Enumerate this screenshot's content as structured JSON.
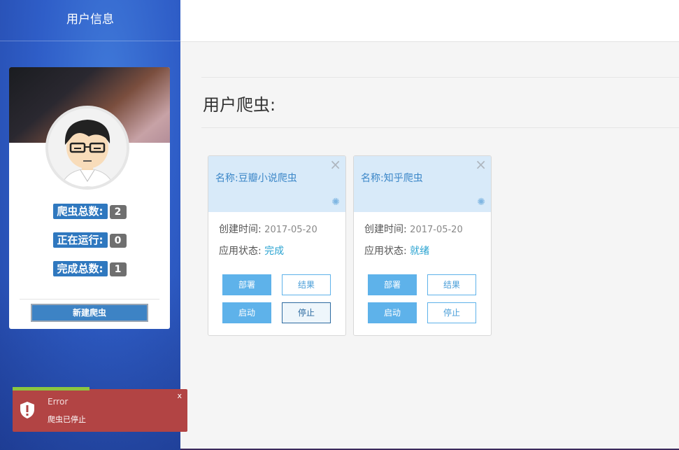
{
  "sidebar": {
    "title": "用户信息",
    "stats": [
      {
        "label": "爬虫总数:",
        "count": "2"
      },
      {
        "label": "正在运行:",
        "count": "0"
      },
      {
        "label": "完成总数:",
        "count": "1"
      }
    ],
    "new_button": "新建爬虫"
  },
  "main": {
    "title": "用户爬虫:"
  },
  "cards": [
    {
      "name": "名称:豆瓣小说爬虫",
      "created_label": "创建时间:",
      "created_value": "2017-05-20",
      "status_label": "应用状态:",
      "status_value": "完成",
      "buttons": {
        "deploy": "部署",
        "result": "结果",
        "start": "启动",
        "stop": "停止"
      },
      "close": "×"
    },
    {
      "name": "名称:知乎爬虫",
      "created_label": "创建时间:",
      "created_value": "2017-05-20",
      "status_label": "应用状态:",
      "status_value": "就绪",
      "buttons": {
        "deploy": "部署",
        "result": "结果",
        "start": "启动",
        "stop": "停止"
      },
      "close": "×"
    }
  ],
  "toast": {
    "title": "Error",
    "message": "爬虫已停止",
    "close": "x"
  },
  "colors": {
    "sidebar": "#2f5ec8",
    "accent": "#2f78bf",
    "button": "#5eb2ea",
    "toast": "#b24444",
    "toast_progress": "#8cc63f"
  },
  "icons": {
    "card_bug": "spider-icon",
    "toast": "shield-alert-icon"
  }
}
